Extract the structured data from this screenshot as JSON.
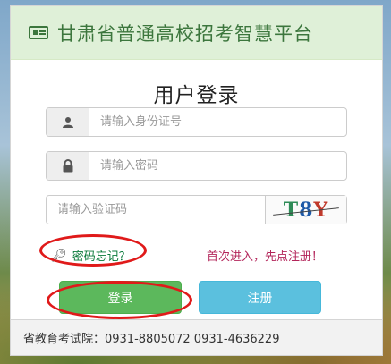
{
  "header": {
    "title": "甘肃省普通高校招考智慧平台",
    "icon": "id-card-icon"
  },
  "login": {
    "title": "用户登录",
    "id_placeholder": "请输入身份证号",
    "password_placeholder": "请输入密码",
    "captcha_placeholder": "请输入验证码",
    "captcha_chars": [
      "T",
      "8",
      "Y"
    ],
    "forgot_label": "密码忘记？",
    "first_time_text": "首次进入，先点注册！",
    "login_label": "登录",
    "register_label": "注册"
  },
  "footer": {
    "text": "省教育考试院：0931-8805072 0931-4636229"
  },
  "colors": {
    "header_bg": "#dff0d8",
    "header_text": "#3c763d",
    "login_button": "#5cb85c",
    "register_button": "#5bc0de",
    "highlight_ellipse": "#e01a1a"
  }
}
